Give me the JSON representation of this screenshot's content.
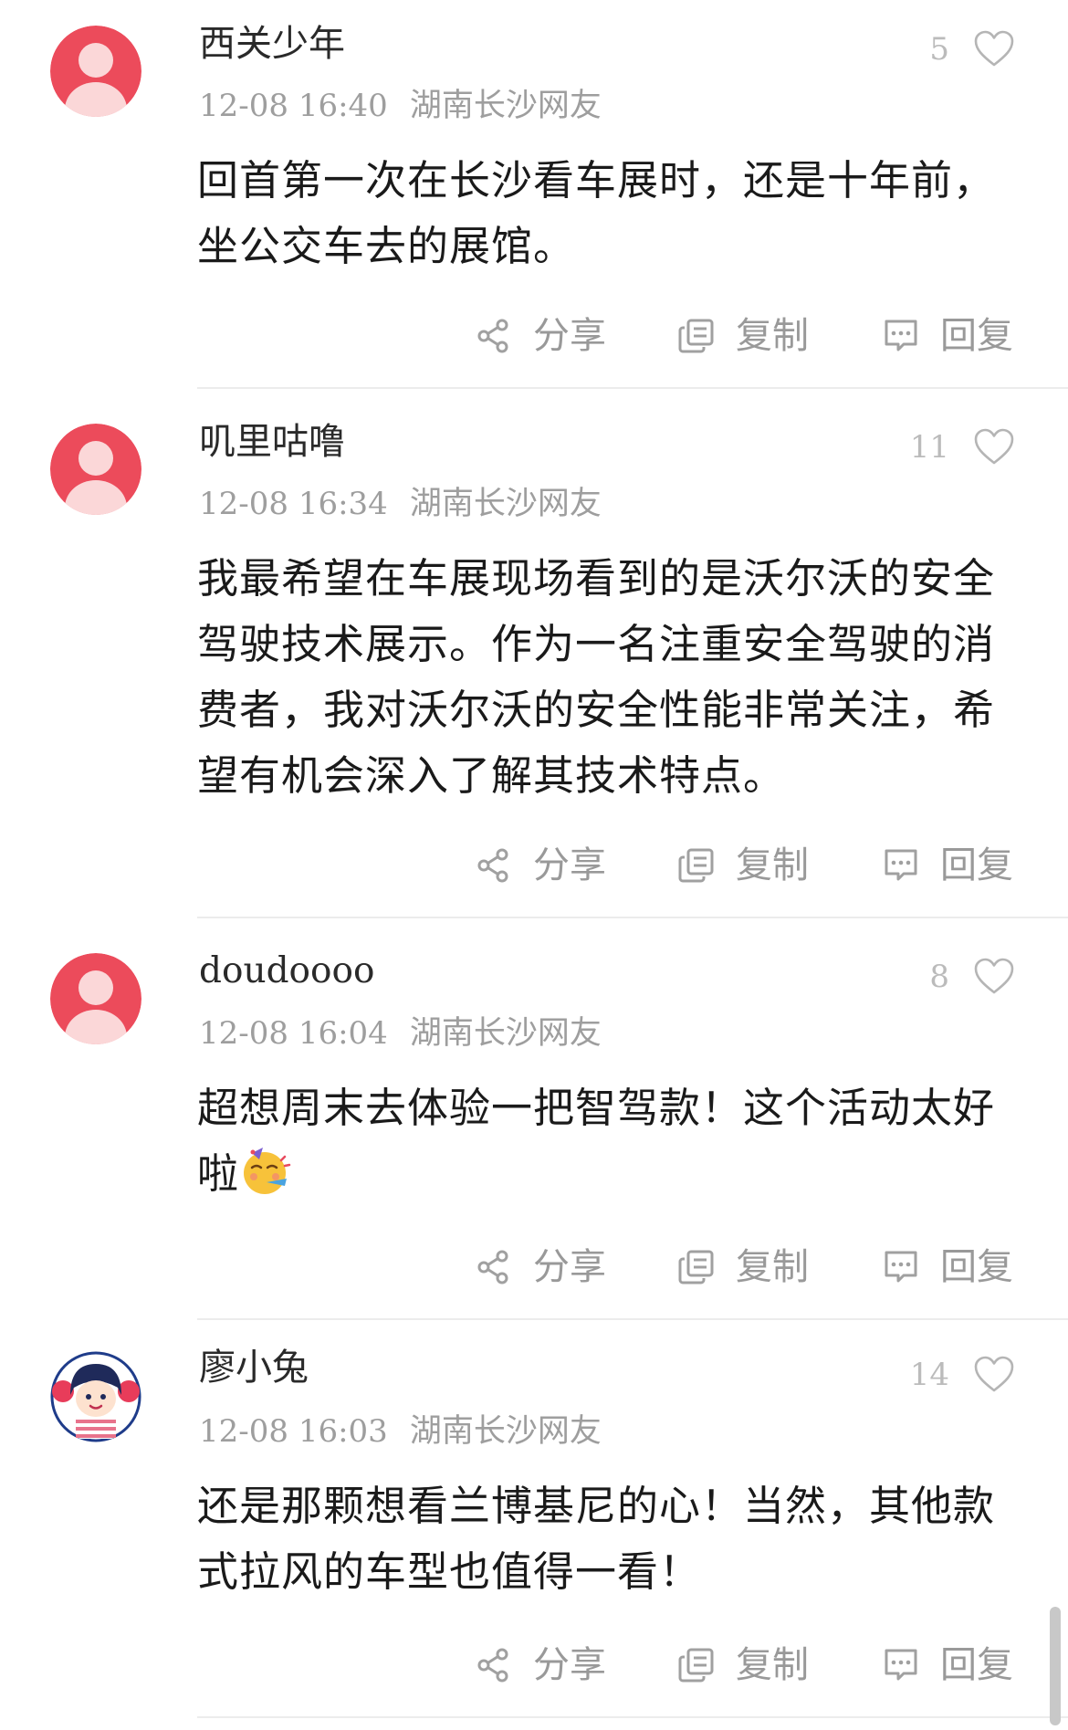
{
  "actions": {
    "share_label": "分享",
    "copy_label": "复制",
    "reply_label": "回复",
    "share_icon": "share-icon",
    "copy_icon": "copy-icon",
    "reply_icon": "reply-icon"
  },
  "colors": {
    "avatar_bg": "#ec4b5b",
    "avatar_fg": "#fbd7d8",
    "muted_text": "#9e9e9e",
    "content_text": "#1a1a1a",
    "icon_gray": "#a0a0a0"
  },
  "comments": [
    {
      "username": "西关少年",
      "time": "12-08 16:40",
      "location": "湖南长沙网友",
      "likes": "5",
      "content": "回首第一次在长沙看车展时，还是十年前，坐公交车去的展馆。",
      "avatar": "default-avatar"
    },
    {
      "username": "叽里咕噜",
      "time": "12-08 16:34",
      "location": "湖南长沙网友",
      "likes": "11",
      "content": "我最希望在车展现场看到的是沃尔沃的安全驾驶技术展示。作为一名注重安全驾驶的消费者，我对沃尔沃的安全性能非常关注，希望有机会深入了解其技术特点。",
      "avatar": "default-avatar"
    },
    {
      "username": "doudoooo",
      "time": "12-08 16:04",
      "location": "湖南长沙网友",
      "likes": "8",
      "content": "超想周末去体验一把智驾款！这个活动太好啦",
      "content_emoji": "partying-face-emoji",
      "avatar": "default-avatar"
    },
    {
      "username": "廖小兔",
      "time": "12-08 16:03",
      "location": "湖南长沙网友",
      "likes": "14",
      "content": "还是那颗想看兰博基尼的心！当然，其他款式拉风的车型也值得一看！",
      "avatar": "cartoon-girl-avatar"
    }
  ]
}
